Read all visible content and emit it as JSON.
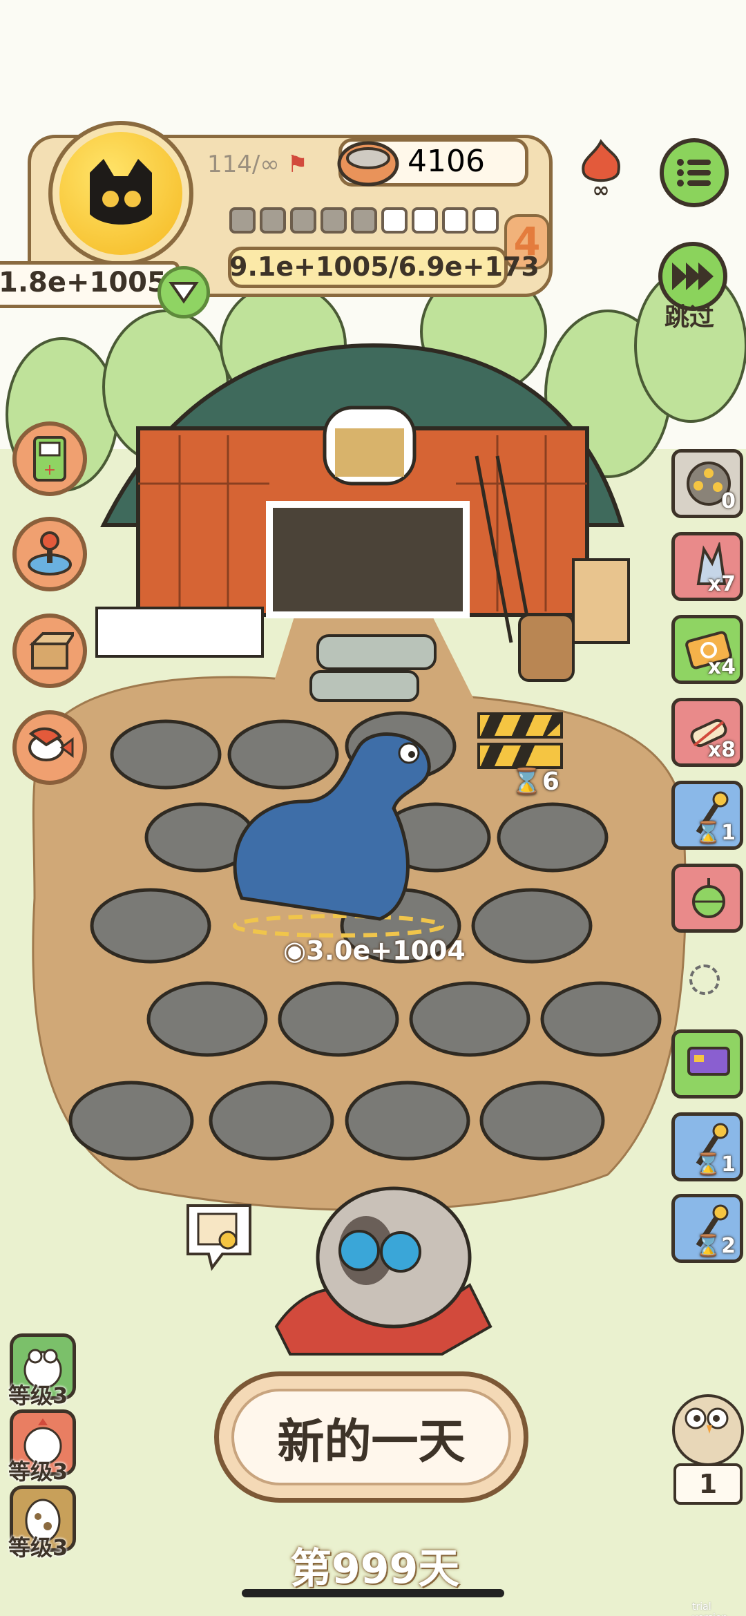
{
  "hud": {
    "level_progress": "114/∞",
    "coins": "4106",
    "progress_label": "9.1e+1005/6.9e+173",
    "level_badge": "4",
    "score": "1.8e+1005",
    "progress_segments_filled": 5,
    "progress_segments_total": 9,
    "skip_label": "跳过"
  },
  "field": {
    "yield_label": "3.0e+1004",
    "timer_label": "6"
  },
  "right_items": [
    {
      "name": "egg-basket",
      "count": "0",
      "color": "#d8d2c7"
    },
    {
      "name": "crystal",
      "count": "x7",
      "color": "#e98a8a"
    },
    {
      "name": "swap-ticket",
      "count": "x4",
      "color": "#8fd463"
    },
    {
      "name": "scroll",
      "count": "x8",
      "color": "#e98a8a"
    },
    {
      "name": "shovel",
      "count": "1",
      "color": "#8ab8e8"
    },
    {
      "name": "bell",
      "count": "",
      "color": "#e98a8a"
    },
    {
      "name": "card",
      "count": "",
      "color": "#8fd463"
    },
    {
      "name": "shovel",
      "count": "1",
      "color": "#8ab8e8"
    },
    {
      "name": "shovel",
      "count": "2",
      "color": "#8ab8e8"
    }
  ],
  "level_badges": [
    {
      "label": "等级3",
      "color": "#7bc06a"
    },
    {
      "label": "等级3",
      "color": "#e97e62"
    },
    {
      "label": "等级3",
      "color": "#c8a05a"
    }
  ],
  "buttons": {
    "new_day": "新的一天",
    "day_counter": "第999天"
  },
  "owl_count": "1",
  "watermark": "trial version"
}
